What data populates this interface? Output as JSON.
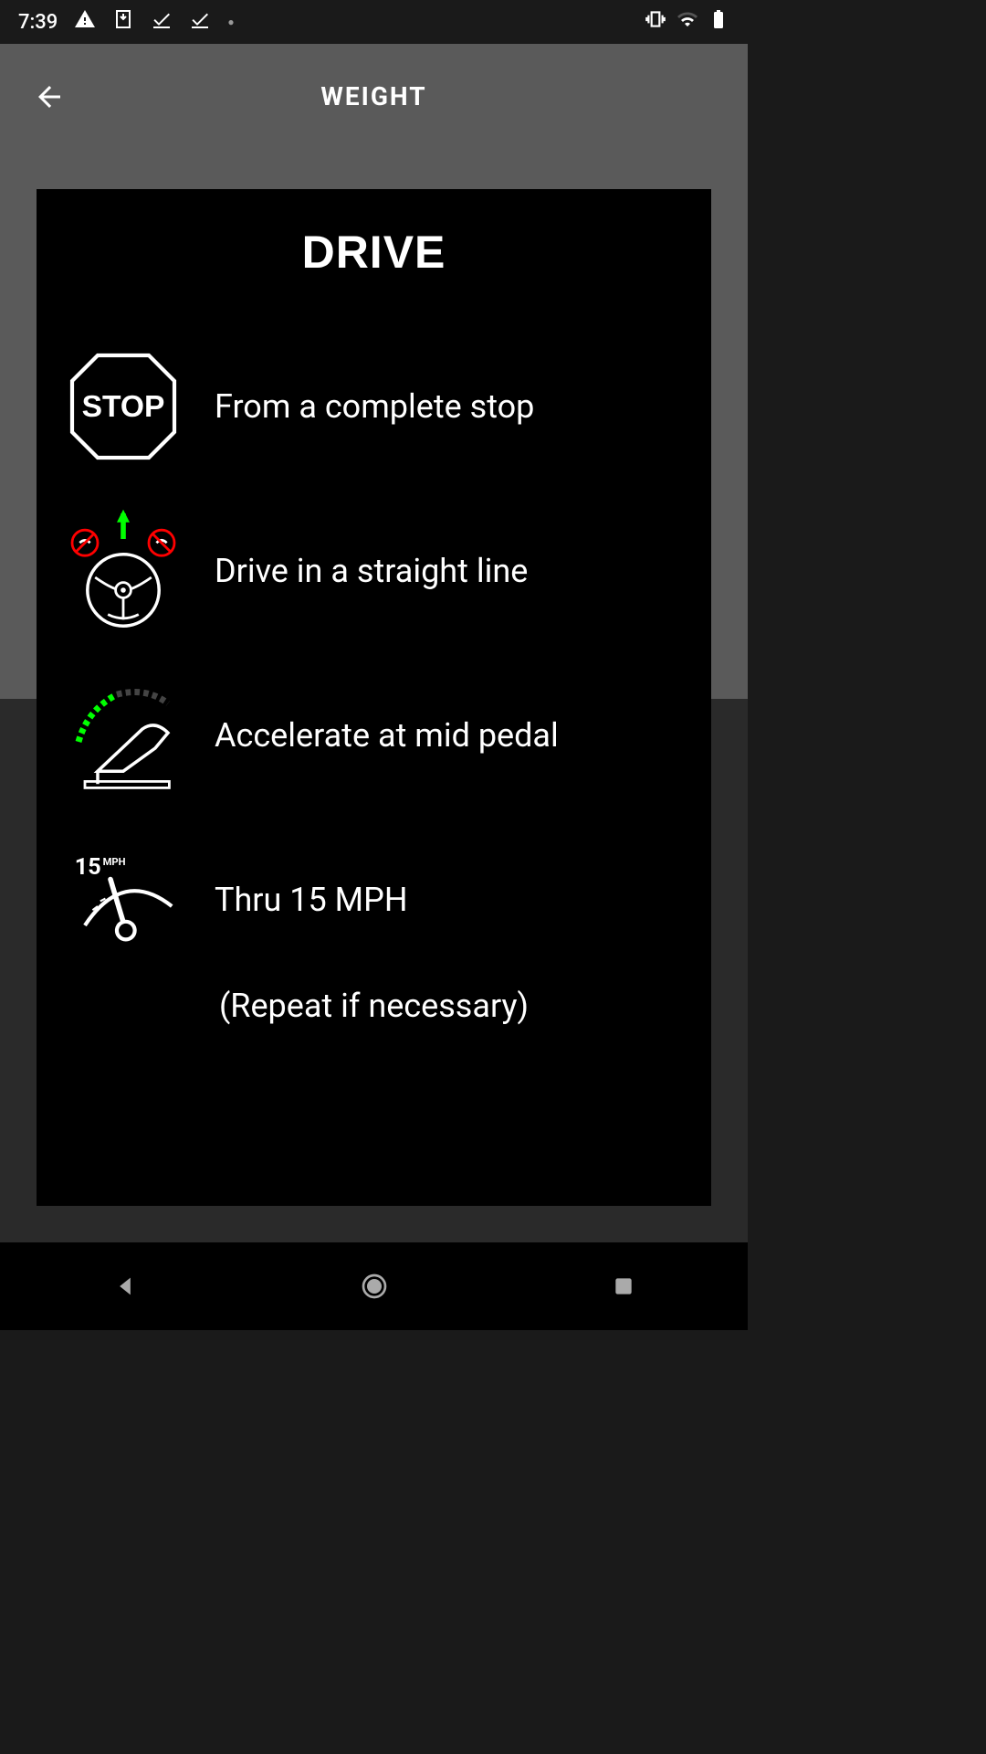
{
  "status_bar": {
    "time": "7:39"
  },
  "header": {
    "title": "WEIGHT"
  },
  "modal": {
    "title": "DRIVE",
    "instructions": [
      {
        "text": "From a complete stop"
      },
      {
        "text": "Drive in a straight line"
      },
      {
        "text": "Accelerate at mid pedal"
      },
      {
        "text": "Thru 15 MPH"
      }
    ],
    "repeat_note": "(Repeat if necessary)"
  }
}
